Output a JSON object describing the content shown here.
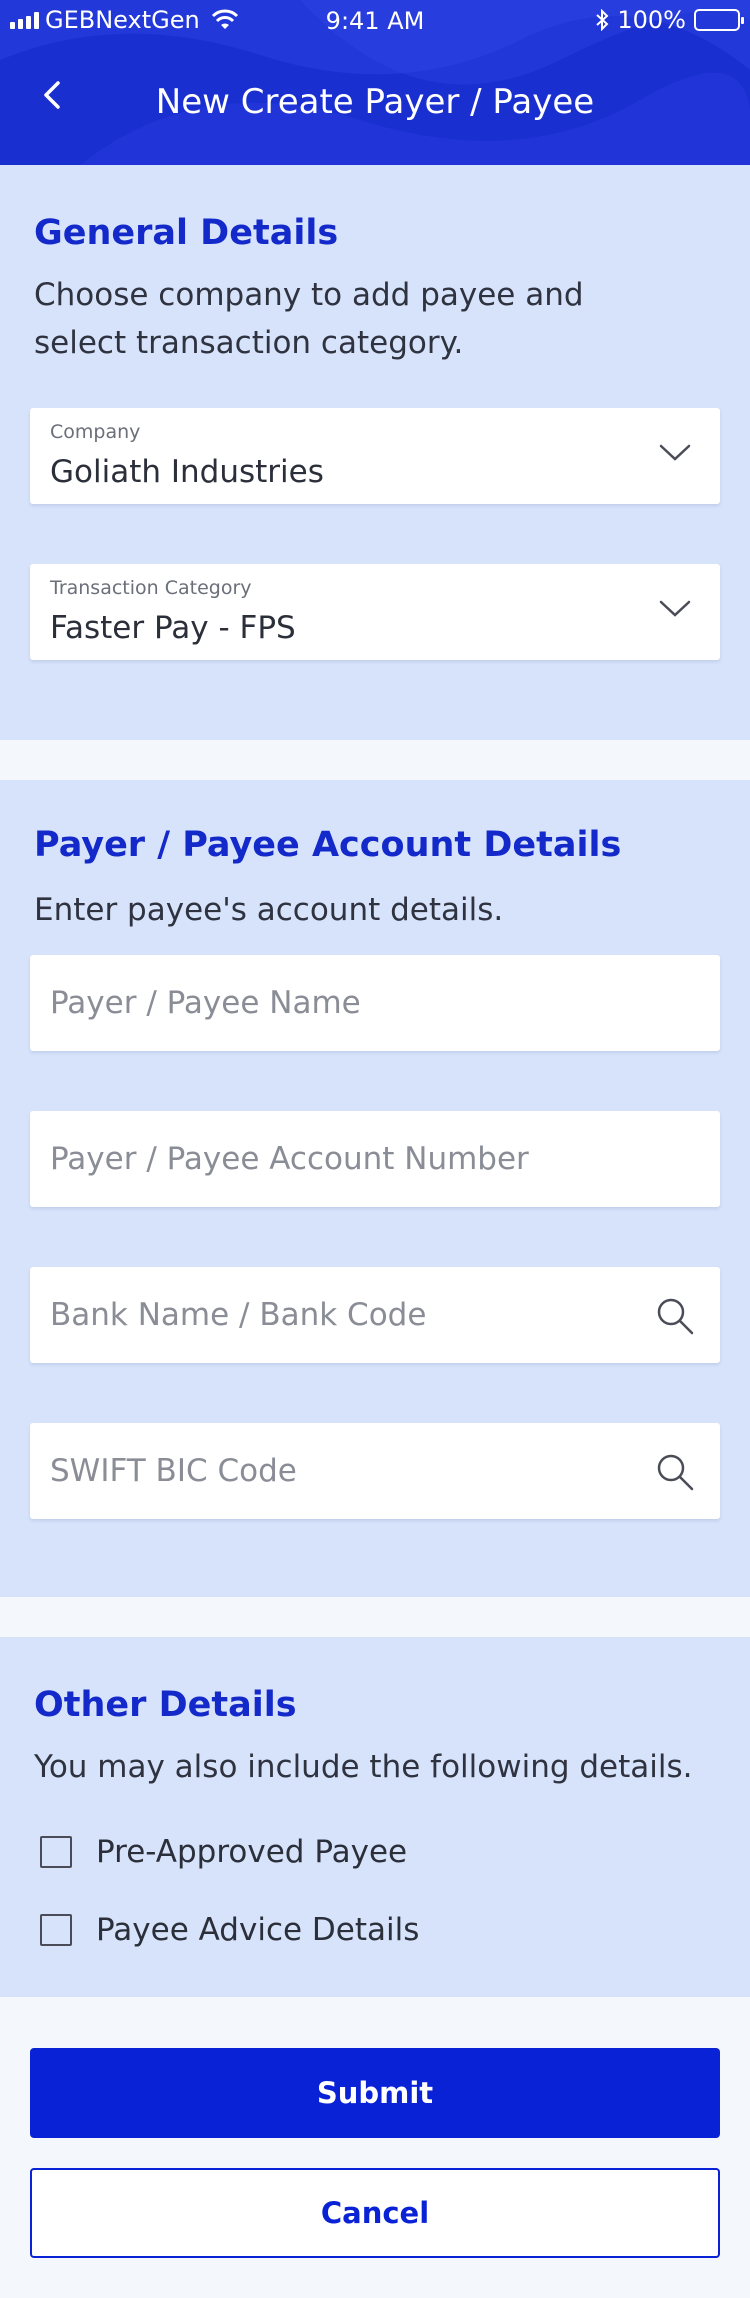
{
  "status_bar": {
    "carrier": "GEBNextGen",
    "time": "9:41 AM",
    "battery": "100%"
  },
  "header": {
    "title": "New Create Payer / Payee",
    "back_icon": "chevron-left-icon"
  },
  "general": {
    "title": "General Details",
    "desc_line1": "Choose company to add payee and",
    "desc_line2": "select transaction category.",
    "company": {
      "label": "Company",
      "value": "Goliath Industries"
    },
    "category": {
      "label": "Transaction Category",
      "value": "Faster Pay - FPS"
    }
  },
  "account": {
    "title": "Payer / Payee Account Details",
    "desc": "Enter payee's account details.",
    "name_placeholder": "Payer / Payee Name",
    "number_placeholder": "Payer / Payee Account Number",
    "bank_placeholder": "Bank Name / Bank Code",
    "swift_placeholder": "SWIFT BIC Code"
  },
  "other": {
    "title": "Other Details",
    "desc": "You may also include the following details.",
    "options": [
      {
        "label": "Pre-Approved Payee",
        "checked": false
      },
      {
        "label": "Payee Advice Details",
        "checked": false
      }
    ]
  },
  "actions": {
    "submit": "Submit",
    "cancel": "Cancel"
  },
  "colors": {
    "header_bg": "#1a2fd0",
    "section_bg": "#d7e3fb",
    "accent": "#0a22d6"
  }
}
